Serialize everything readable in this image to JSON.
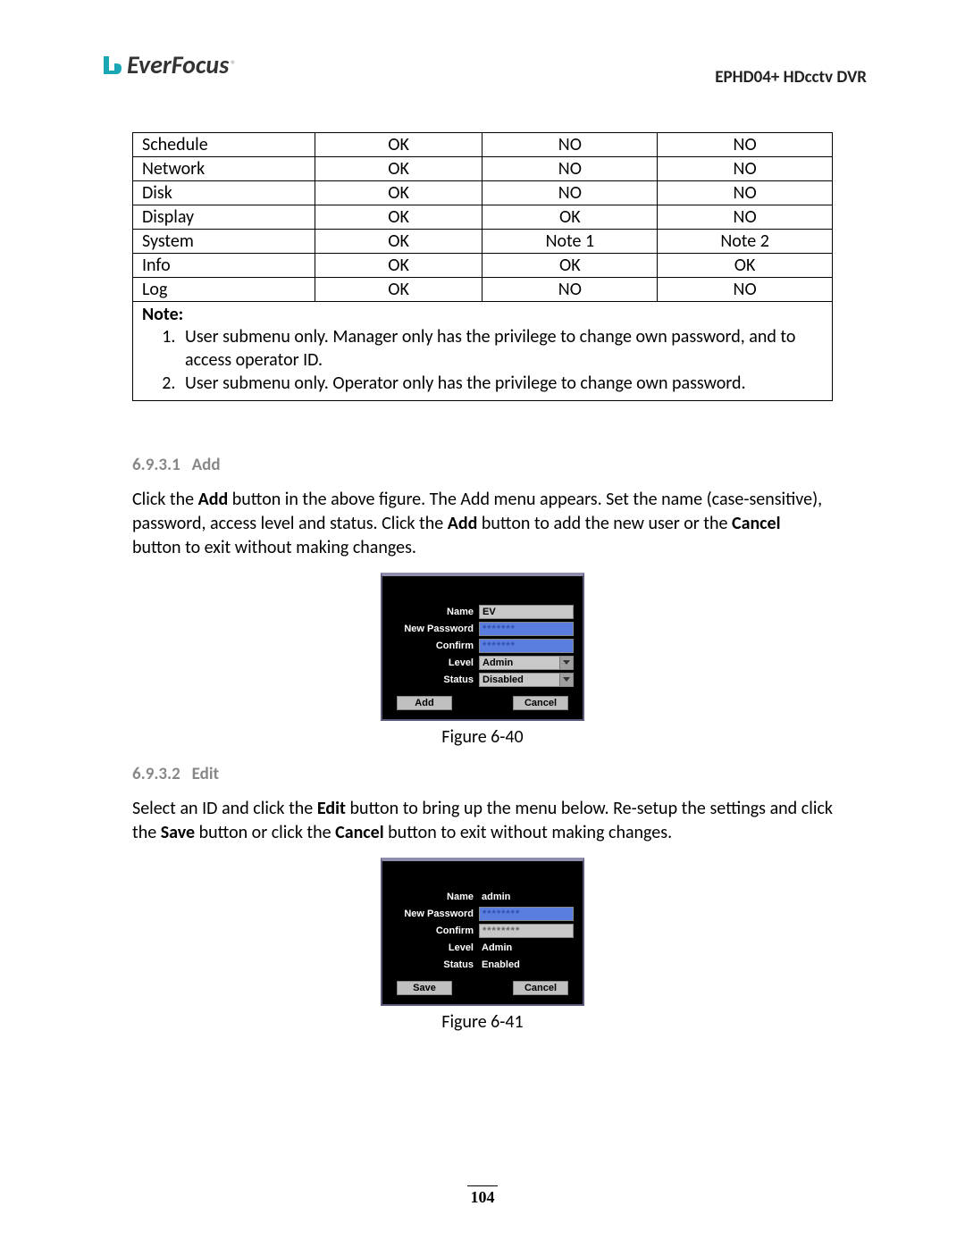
{
  "header": {
    "brand": "EverFocus",
    "product": "EPHD04+  HDcctv DVR"
  },
  "table": {
    "rows": [
      {
        "c0": "Schedule",
        "c1": "OK",
        "c2": "NO",
        "c3": "NO"
      },
      {
        "c0": "Network",
        "c1": "OK",
        "c2": "NO",
        "c3": "NO"
      },
      {
        "c0": "Disk",
        "c1": "OK",
        "c2": "NO",
        "c3": "NO"
      },
      {
        "c0": "Display",
        "c1": "OK",
        "c2": "OK",
        "c3": "NO"
      },
      {
        "c0": "System",
        "c1": "OK",
        "c2": "Note 1",
        "c3": "Note 2"
      },
      {
        "c0": "Info",
        "c1": "OK",
        "c2": "OK",
        "c3": "OK"
      },
      {
        "c0": "Log",
        "c1": "OK",
        "c2": "NO",
        "c3": "NO"
      }
    ]
  },
  "notes": {
    "label": "Note:",
    "items": [
      "User submenu only. Manager only has the privilege to change own password, and to access operator ID.",
      "User submenu only. Operator only has the privilege to change own password."
    ]
  },
  "section_add": {
    "number": "6.9.3.1",
    "title": "Add",
    "p1a": "Click the ",
    "p1_add": "Add",
    "p1b": " button in the above figure. The Add menu appears. Set the name (case-sensitive), password, access level and status. Click the ",
    "p1_add2": "Add",
    "p1c": " button to add the new user or the ",
    "p1_cancel": "Cancel",
    "p1d": " button to exit without making changes."
  },
  "dialog_add": {
    "labels": {
      "name": "Name",
      "newpw": "New Password",
      "confirm": "Confirm",
      "level": "Level",
      "status": "Status"
    },
    "values": {
      "name": "EV",
      "newpw": "*******",
      "confirm": "*******",
      "level": "Admin",
      "status": "Disabled"
    },
    "buttons": {
      "ok": "Add",
      "cancel": "Cancel"
    },
    "caption": "Figure 6-40"
  },
  "section_edit": {
    "number": "6.9.3.2",
    "title": "Edit",
    "p1a": "Select an ID and click the ",
    "p1_edit": "Edit",
    "p1b": " button to bring up the menu below. Re-setup the settings and click the ",
    "p1_save": "Save",
    "p1c": " button or click the ",
    "p1_cancel": "Cancel",
    "p1d": " button to exit without making changes."
  },
  "dialog_edit": {
    "labels": {
      "name": "Name",
      "newpw": "New Password",
      "confirm": "Confirm",
      "level": "Level",
      "status": "Status"
    },
    "values": {
      "name": "admin",
      "newpw": "********",
      "confirm": "********",
      "level": "Admin",
      "status": "Enabled"
    },
    "buttons": {
      "ok": "Save",
      "cancel": "Cancel"
    },
    "caption": "Figure 6-41"
  },
  "page_number": "104"
}
